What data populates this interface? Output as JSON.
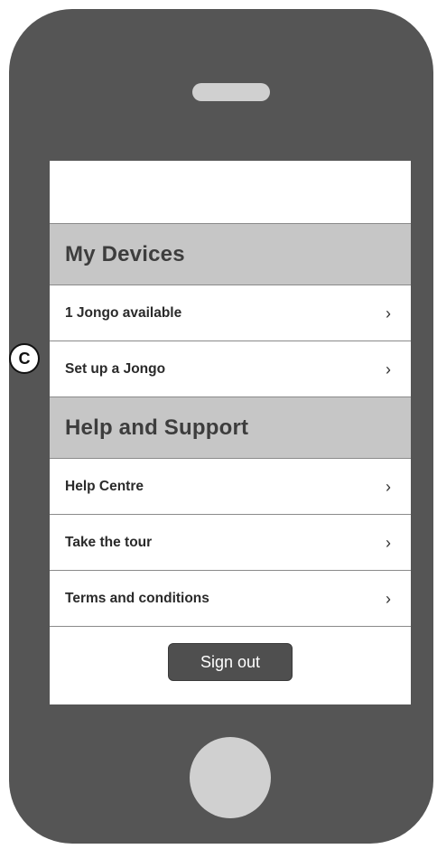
{
  "sections": [
    {
      "title": "My Devices",
      "items": [
        {
          "label": "1 Jongo available",
          "chevron": "›"
        },
        {
          "label": "Set up a Jongo",
          "chevron": "›"
        }
      ]
    },
    {
      "title": "Help and Support",
      "items": [
        {
          "label": "Help Centre",
          "chevron": "›"
        },
        {
          "label": "Take the tour",
          "chevron": "›"
        },
        {
          "label": "Terms and conditions",
          "chevron": "›"
        }
      ]
    }
  ],
  "sign_out_label": "Sign out",
  "annotation_marker": "C",
  "icons": {
    "chevron": "chevron-right-icon"
  },
  "colors": {
    "phone_body": "#555555",
    "section_header_bg": "#c6c6c6",
    "button_bg": "#4f4f4f"
  }
}
